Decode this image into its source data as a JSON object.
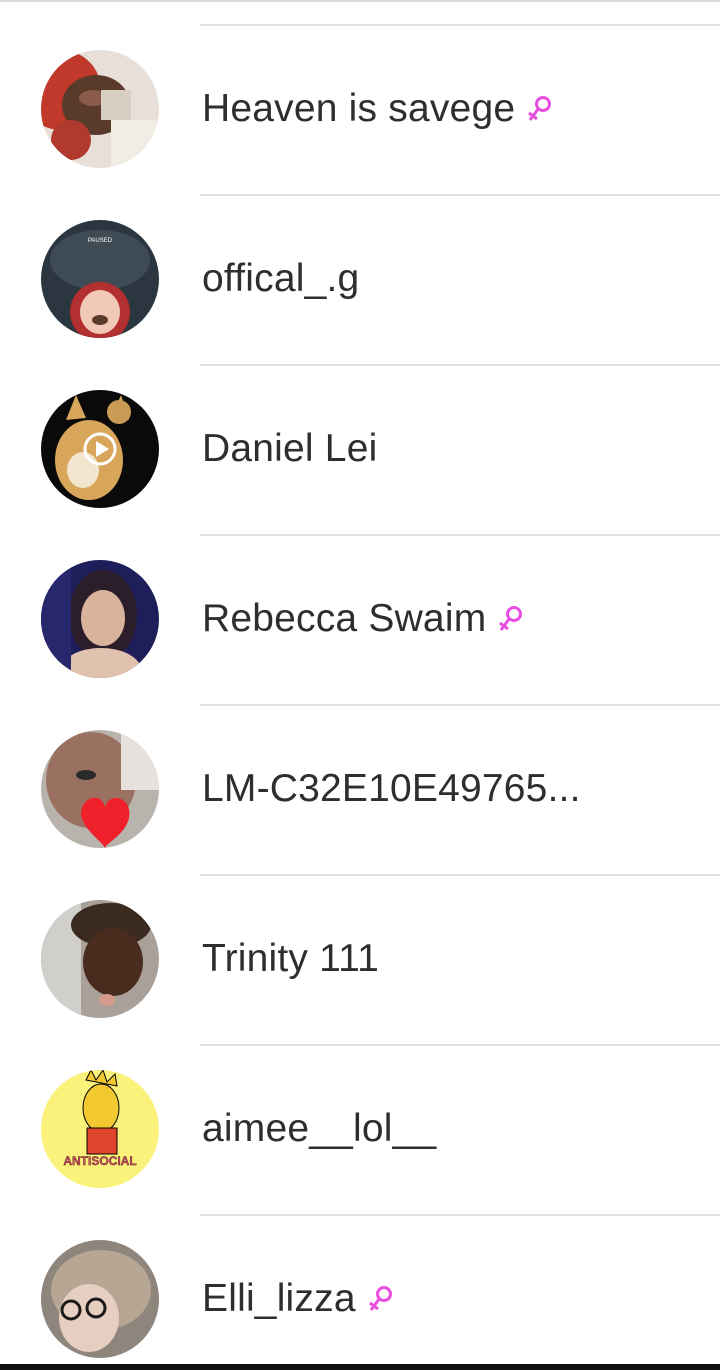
{
  "colors": {
    "female_icon": "#e84fe0",
    "name_text": "#2e2e2e",
    "divider": "#e0e0e0"
  },
  "contacts": [
    {
      "name": "Heaven is savege",
      "female_icon": true
    },
    {
      "name": "offical_.g",
      "female_icon": false,
      "avatar_overlay_text": "PAUSED"
    },
    {
      "name": "Daniel Lei",
      "female_icon": false
    },
    {
      "name": "Rebecca Swaim",
      "female_icon": true
    },
    {
      "name": "LM-C32E10E49765...",
      "female_icon": false
    },
    {
      "name": "Trinity 111",
      "female_icon": false
    },
    {
      "name": "aimee__lol__",
      "female_icon": false,
      "avatar_overlay_text": "ANTISOCIAL"
    },
    {
      "name": "Elli_lizza",
      "female_icon": true
    }
  ]
}
